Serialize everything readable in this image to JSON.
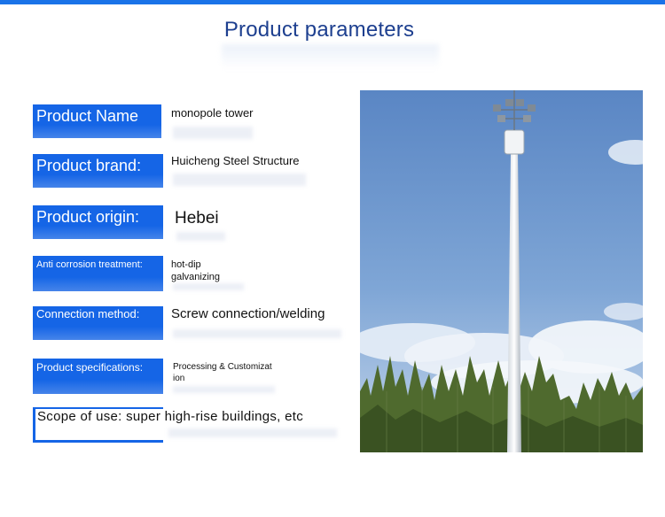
{
  "title": "Product parameters",
  "parameters": [
    {
      "label": "Product Name",
      "value": "monopole tower"
    },
    {
      "label": "Product brand:",
      "value": "Huicheng Steel Structure"
    },
    {
      "label": "Product origin:",
      "value": "Hebei"
    },
    {
      "label": "Anti corrosion treatment:",
      "value_line1": "hot-dip",
      "value_line2": "galvanizing"
    },
    {
      "label": "Connection method:",
      "value": "Screw connection/welding"
    },
    {
      "label": "Product specifications:",
      "value_line1": "Processing & Customizat",
      "value_line2": "ion"
    }
  ],
  "scope": "Scope of use: super high-rise buildings, etc",
  "colors": {
    "accent": "#1565e6",
    "title": "#1d3f8f",
    "top_bar": "#1a73e8"
  },
  "photo": {
    "subject": "monopole-tower-photo"
  }
}
